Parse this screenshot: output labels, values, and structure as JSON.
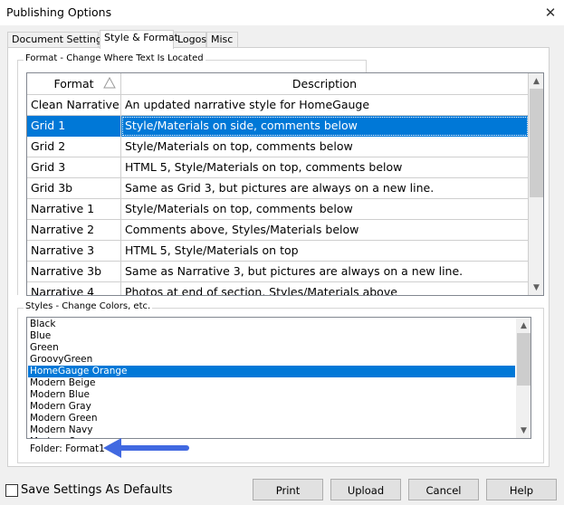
{
  "window": {
    "title": "Publishing Options"
  },
  "tabs": [
    {
      "label": "Document Settings"
    },
    {
      "label": "Style & Format"
    },
    {
      "label": "Logos"
    },
    {
      "label": "Misc"
    }
  ],
  "format_group": {
    "label": "Format - Change Where Text Is Located",
    "columns": [
      "Format",
      "Description"
    ],
    "sort_icon": "sort-ascending-icon",
    "rows": [
      {
        "format": "Clean Narrative",
        "description": "An updated narrative style for HomeGauge"
      },
      {
        "format": "Grid 1",
        "description": "Style/Materials on side, comments below",
        "selected": true
      },
      {
        "format": "Grid 2",
        "description": "Style/Materials on top, comments below"
      },
      {
        "format": "Grid 3",
        "description": "HTML 5, Style/Materials on top, comments below"
      },
      {
        "format": "Grid 3b",
        "description": "Same as Grid 3, but pictures are always on a new line."
      },
      {
        "format": "Narrative 1",
        "description": "Style/Materials on top, comments below"
      },
      {
        "format": "Narrative 2",
        "description": "Comments above, Styles/Materials below"
      },
      {
        "format": "Narrative 3",
        "description": "HTML 5, Style/Materials on top"
      },
      {
        "format": "Narrative 3b",
        "description": "Same as Narrative 3, but pictures are always on a new line."
      },
      {
        "format": "Narrative 4",
        "description": "Photos at end of section, Styles/Materials above"
      }
    ]
  },
  "styles_group": {
    "label": "Styles - Change Colors, etc.",
    "items": [
      "Black",
      "Blue",
      "Green",
      "GroovyGreen",
      "HomeGauge Orange",
      "Modern Beige",
      "Modern Blue",
      "Modern Gray",
      "Modern Green",
      "Modern Navy",
      "Modern Orange"
    ],
    "selected_index": 4,
    "folder_label": "Folder: Format1"
  },
  "footer": {
    "save_defaults_label": "Save Settings As Defaults",
    "buttons": [
      "Print",
      "Upload",
      "Cancel",
      "Help"
    ]
  },
  "colors": {
    "selection": "#0078d7",
    "annotation_arrow": "#4169e1"
  }
}
